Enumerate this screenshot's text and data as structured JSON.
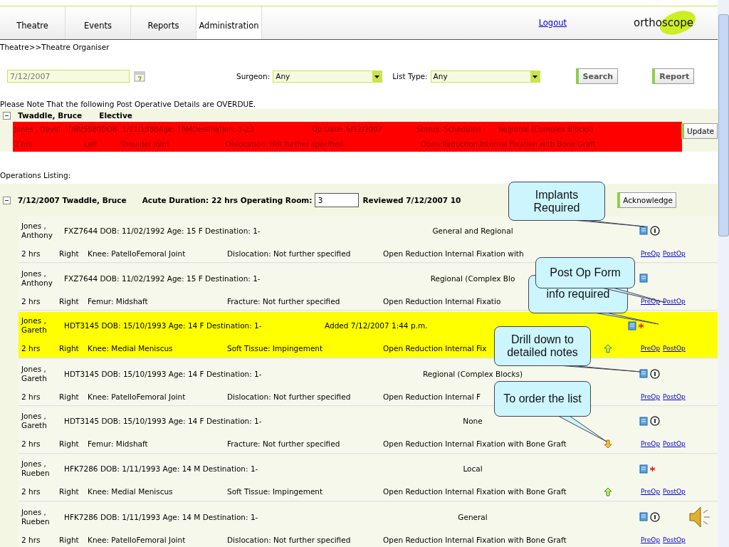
{
  "nav": {
    "tabs": [
      {
        "label": "Theatre",
        "selected": false
      },
      {
        "label": "Events",
        "selected": false
      },
      {
        "label": "Reports",
        "selected": false
      },
      {
        "label": "Administration",
        "selected": true
      }
    ],
    "logout": "Logout",
    "logo": "orthoscope"
  },
  "breadcrumb": "Theatre>>Theatre Organiser",
  "filters": {
    "date": "7/12/2007",
    "surgeon_label": "Surgeon:",
    "surgeon": "Any",
    "list_type_label": "List Type:",
    "list_type": "Any",
    "search": "Search",
    "report": "Report"
  },
  "overdue": {
    "notice": "Please Note That the following Post Operative Details are OVERDUE.",
    "expanded": true,
    "surgeon": "Twaddle, Bruce",
    "type": "Elective",
    "update": "Update",
    "row": {
      "patient": "Jones , David",
      "details": "DRV5980DOB: 1/11/1988Age: 19MDestination: 3-23",
      "op_date": "Op Date: 6/12/2007",
      "status": "Status: Scheduled",
      "anaesthesia": "Regional (Complex Blocks)",
      "duration": "2 hrs",
      "side": "Left",
      "site": "Shoulder Joint",
      "diagnosis": "Dislocation: Not further specified",
      "procedure": "Open Reduction Internal Fixation with Bone Graft"
    }
  },
  "listing": {
    "title": "Operations Listing:",
    "expanded": true,
    "heading": "7/12/2007 Twaddle, Bruce",
    "duration": "Acute Duration: 22 hrs Operating Room:",
    "room": "3",
    "reviewed": "Reviewed 7/12/2007 10",
    "acknowledge": "Acknowledge",
    "rows": [
      {
        "surname": "Jones ,",
        "given": "Anthony",
        "patient": "FXZ7644 DOB: 11/02/1992 Age: 15 F  Destination: 1-",
        "anaesthesia": "General and Regional",
        "duration": "2 hrs",
        "side": "Right",
        "site": "Knee: PatelloFemoral Joint",
        "diagnosis": "Dislocation: Not further specified",
        "procedure": "Open Reduction Internal Fixation with",
        "implants": true,
        "info_required": false,
        "move_up": false,
        "move_down": false,
        "highlighted": false,
        "preop": "PreOp",
        "postop": "PostOp"
      },
      {
        "surname": "Jones ,",
        "given": "Anthony",
        "patient": "FXZ7644 DOB: 11/02/1992 Age: 15 F  Destination: 1-",
        "anaesthesia": "Regional (Complex Blo",
        "duration": "2 hrs",
        "side": "Right",
        "site": "Femur: Midshaft",
        "diagnosis": "Fracture: Not further specified",
        "procedure": "Open Reduction Internal Fixatio",
        "implants": false,
        "info_required": false,
        "move_up": false,
        "move_down": false,
        "highlighted": false,
        "preop": "PreOp",
        "postop": "PostOp"
      },
      {
        "surname": "Jones ,",
        "given": "Gareth",
        "patient": "HDT3145 DOB: 15/10/1993 Age: 14 F  Destination: 1-",
        "added": "Added 7/12/2007 1:44 p.m.",
        "duration": "2 hrs",
        "side": "Right",
        "site": "Knee: Medial Meniscus",
        "diagnosis": "Soft Tissue: Impingement",
        "procedure": "Open Reduction Internal Fix",
        "implants": false,
        "info_required": true,
        "move_up": true,
        "move_down": false,
        "highlighted": true,
        "preop": "PreOp",
        "postop": "PostOp"
      },
      {
        "surname": "Jones ,",
        "given": "Gareth",
        "patient": "HDT3145 DOB: 15/10/1993 Age: 14 F  Destination: 1-",
        "anaesthesia": "Regional (Complex Blocks)",
        "duration": "2 hrs",
        "side": "Right",
        "site": "Knee: PatelloFemoral Joint",
        "diagnosis": "Dislocation: Not further specified",
        "procedure": "Open Reduction Internal F",
        "implants": true,
        "info_required": false,
        "move_up": false,
        "move_down": false,
        "highlighted": false,
        "preop": "PreOp",
        "postop": "PostOp"
      },
      {
        "surname": "Jones ,",
        "given": "Gareth",
        "patient": "HDT3145 DOB: 15/10/1993 Age: 14 F  Destination: 1-",
        "anaesthesia": "None",
        "duration": "2 hrs",
        "side": "Right",
        "site": "Femur: Midshaft",
        "diagnosis": "Fracture: Not further specified",
        "procedure": "Open Reduction Internal Fixation with Bone Graft",
        "implants": true,
        "info_required": false,
        "move_up": false,
        "move_down": true,
        "highlighted": false,
        "preop": "PreOp",
        "postop": "PostOp"
      },
      {
        "surname": "Jones ,",
        "given": "Rueben",
        "patient": "HFK7286 DOB: 1/11/1993 Age: 14 M  Destination: 1-",
        "anaesthesia": "Local",
        "duration": "2 hrs",
        "side": "Right",
        "site": "Knee: Medial Meniscus",
        "diagnosis": "Soft Tissue: Impingement",
        "procedure": "Open Reduction Internal Fixation with Bone Graft",
        "implants": false,
        "info_required": true,
        "move_up": true,
        "move_down": false,
        "highlighted": false,
        "preop": "PreOp",
        "postop": "PostOp"
      },
      {
        "surname": "Jones ,",
        "given": "Rueben",
        "patient": "HFK7286 DOB: 1/11/1993 Age: 14 M  Destination: 1-",
        "anaesthesia": "General",
        "duration": "2 hrs",
        "side": "Right",
        "site": "Knee: PatelloFemoral Joint",
        "diagnosis": "Dislocation: Not further specified",
        "procedure": "Open Reduction Internal Fixation with Bone Graft",
        "implants": true,
        "info_required": false,
        "move_up": false,
        "move_down": false,
        "highlighted": false,
        "preop": "PreOp",
        "postop": "PostOp"
      }
    ]
  },
  "callouts": [
    {
      "text": "Implants Required"
    },
    {
      "text": "Post Op Form"
    },
    {
      "text": "info required"
    },
    {
      "text": "Drill down to detailed notes"
    },
    {
      "text": "To order the list"
    }
  ]
}
